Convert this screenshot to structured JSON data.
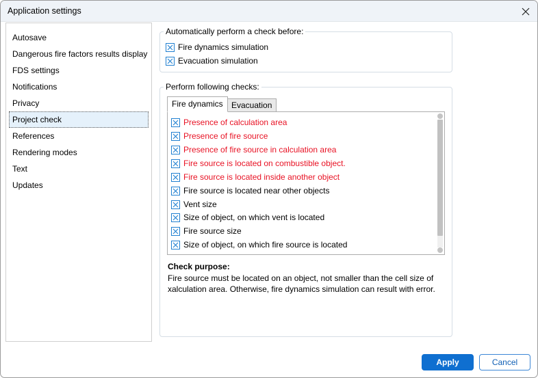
{
  "window": {
    "title": "Application settings",
    "close_icon": "close-icon"
  },
  "sidebar": {
    "items": [
      {
        "label": "Autosave",
        "selected": false
      },
      {
        "label": "Dangerous fire factors results display",
        "selected": false
      },
      {
        "label": "FDS settings",
        "selected": false
      },
      {
        "label": "Notifications",
        "selected": false
      },
      {
        "label": "Privacy",
        "selected": false
      },
      {
        "label": "Project check",
        "selected": true
      },
      {
        "label": "References",
        "selected": false
      },
      {
        "label": "Rendering modes",
        "selected": false
      },
      {
        "label": "Text",
        "selected": false
      },
      {
        "label": "Updates",
        "selected": false
      }
    ]
  },
  "auto_check": {
    "legend": "Automatically perform a check before:",
    "options": [
      {
        "label": "Fire dynamics simulation",
        "checked": true
      },
      {
        "label": "Evacuation simulation",
        "checked": true
      }
    ]
  },
  "checks": {
    "legend": "Perform following checks:",
    "tabs": [
      {
        "label": "Fire dynamics",
        "active": true
      },
      {
        "label": "Evacuation",
        "active": false
      }
    ],
    "items": [
      {
        "label": "Presence of calculation area",
        "checked": true,
        "critical": true
      },
      {
        "label": "Presence of fire source",
        "checked": true,
        "critical": true
      },
      {
        "label": "Presence of fire source in calculation area",
        "checked": true,
        "critical": true
      },
      {
        "label": "Fire source is located on combustible object.",
        "checked": true,
        "critical": true
      },
      {
        "label": "Fire source is located inside another object",
        "checked": true,
        "critical": true
      },
      {
        "label": "Fire source is located near other objects",
        "checked": true,
        "critical": false
      },
      {
        "label": "Vent size",
        "checked": true,
        "critical": false
      },
      {
        "label": "Size of object, on which vent is located",
        "checked": true,
        "critical": false
      },
      {
        "label": "Fire source size",
        "checked": true,
        "critical": false
      },
      {
        "label": "Size of object, on which fire source is located",
        "checked": true,
        "critical": false
      }
    ],
    "purpose_title": "Check purpose:",
    "purpose_text": "Fire source must be located on an object, not smaller than the cell size of xalculation area. Otherwise, fire dynamics simulation can result with error."
  },
  "buttons": {
    "apply": "Apply",
    "cancel": "Cancel"
  },
  "colors": {
    "accent": "#0f6fd0",
    "critical_text": "#e81123",
    "checkbox_border": "#1f7fd0",
    "selection_bg": "#e5f1fb"
  }
}
